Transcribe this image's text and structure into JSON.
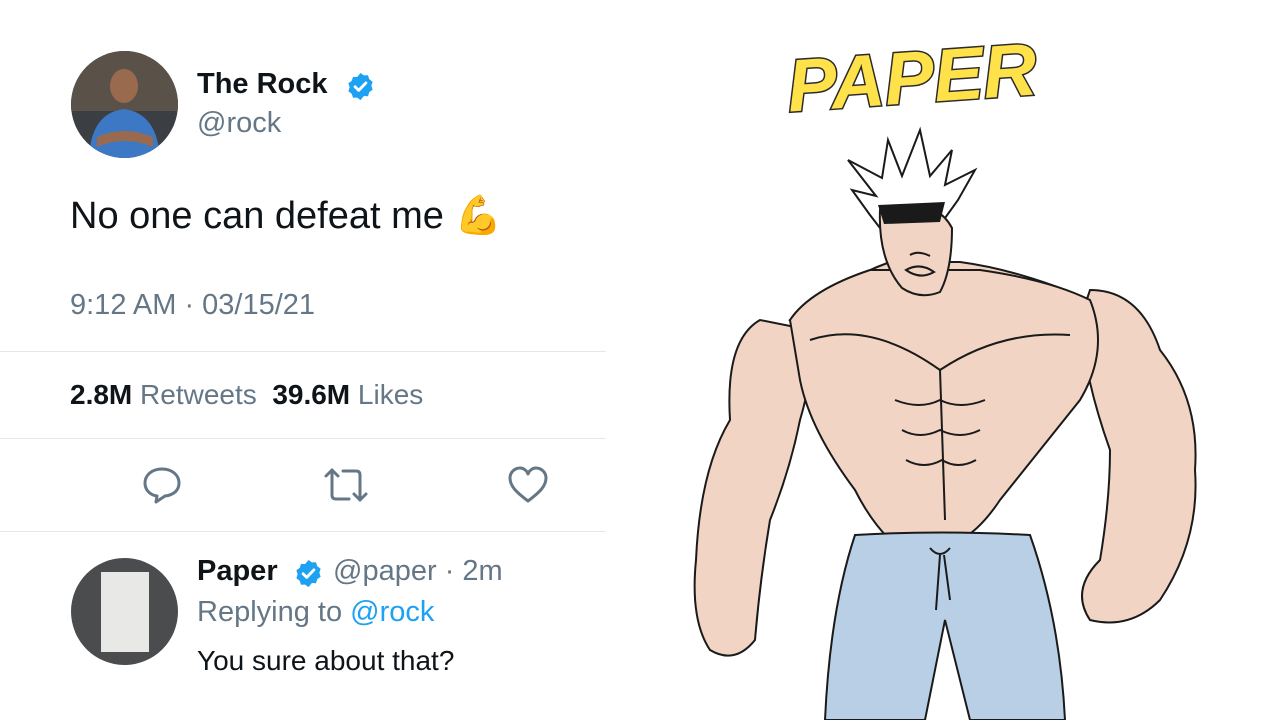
{
  "tweet": {
    "author_name": "The Rock",
    "author_handle": "@rock",
    "text": "No one can defeat me",
    "emoji": "💪",
    "timestamp": "9:12 AM · 03/15/21",
    "retweets_count": "2.8M",
    "retweets_label": "Retweets",
    "likes_count": "39.6M",
    "likes_label": "Likes",
    "icons": [
      "comment-icon",
      "retweet-icon",
      "like-icon",
      "verified-badge-icon"
    ]
  },
  "reply": {
    "author_name": "Paper",
    "author_handle": "@paper",
    "time_ago": "· 2m",
    "replying_to_label": "Replying to",
    "replying_to_handle": "@rock",
    "text": "You sure about that?"
  },
  "illustration": {
    "title": "PAPER"
  },
  "colors": {
    "verified_blue": "#1da1f2",
    "secondary_text": "#657786",
    "title_yellow": "#ffe24a",
    "skin": "#f2d4c4",
    "pants": "#b8cfe6"
  }
}
